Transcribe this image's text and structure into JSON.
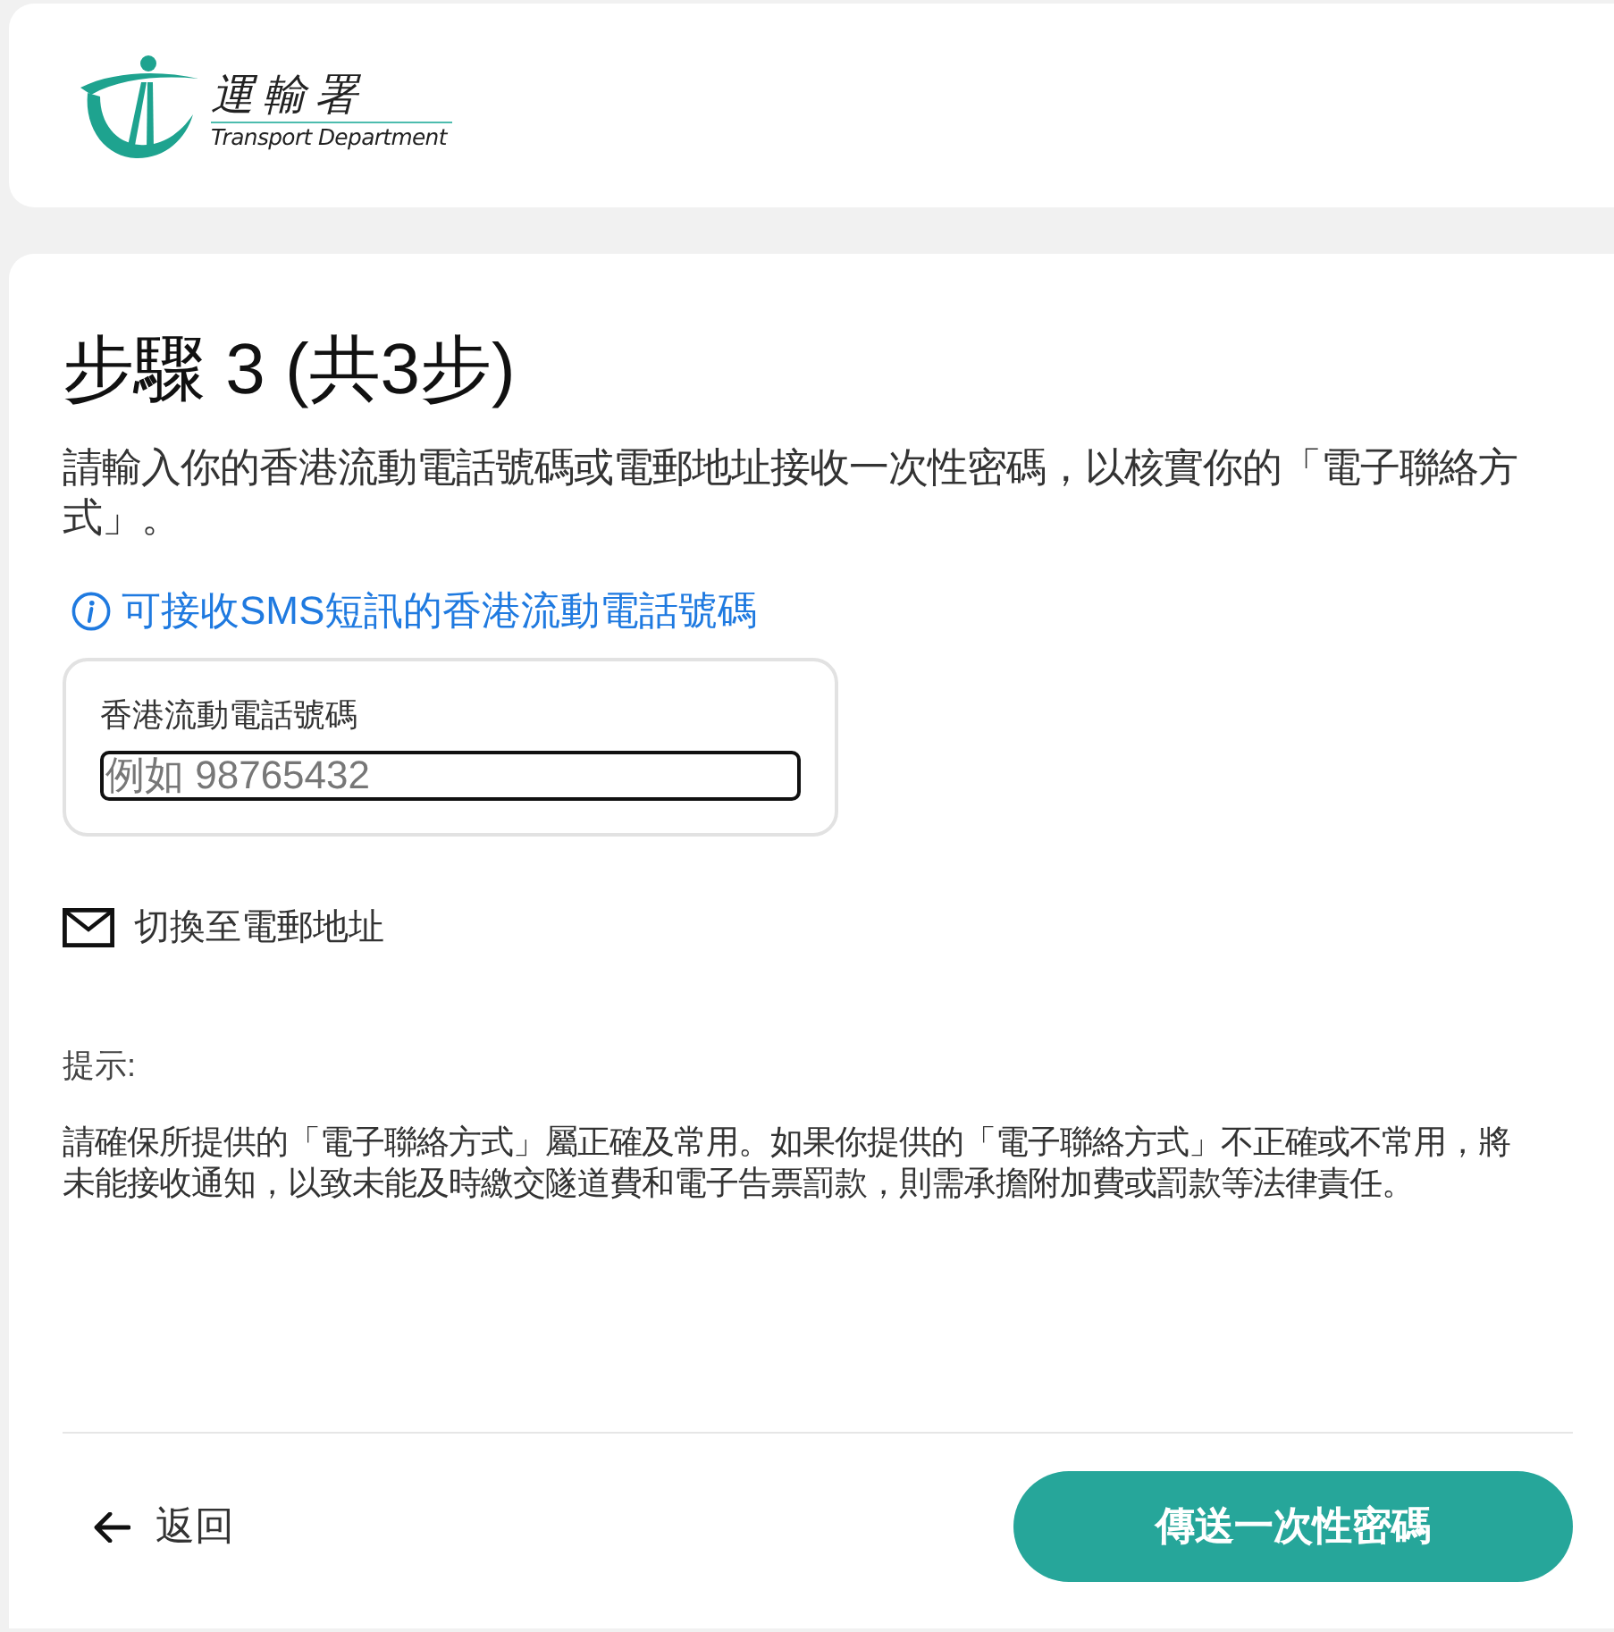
{
  "header": {
    "logo": {
      "title": "運輸署",
      "subtitle": "Transport Department"
    }
  },
  "step": {
    "title": "步驟 3 (共3步)",
    "description": "請輸入你的香港流動電話號碼或電郵地址接收一次性密碼，以核實你的「電子聯絡方式」。"
  },
  "info_link": {
    "label": "可接收SMS短訊的香港流動電話號碼"
  },
  "phone_field": {
    "label": "香港流動電話號碼",
    "placeholder": "例如 98765432",
    "focused": true
  },
  "switch_link": {
    "label": "切換至電郵地址"
  },
  "notice": {
    "heading": "提示:",
    "text": "請確保所提供的「電子聯絡方式」屬正確及常用。如果你提供的「電子聯絡方式」不正確或不常用，將未能接收通知，以致未能及時繳交隧道費和電子告票罰款，則需承擔附加費或罰款等法律責任。"
  },
  "footer": {
    "back": "返回",
    "submit": "傳送一次性密碼"
  }
}
